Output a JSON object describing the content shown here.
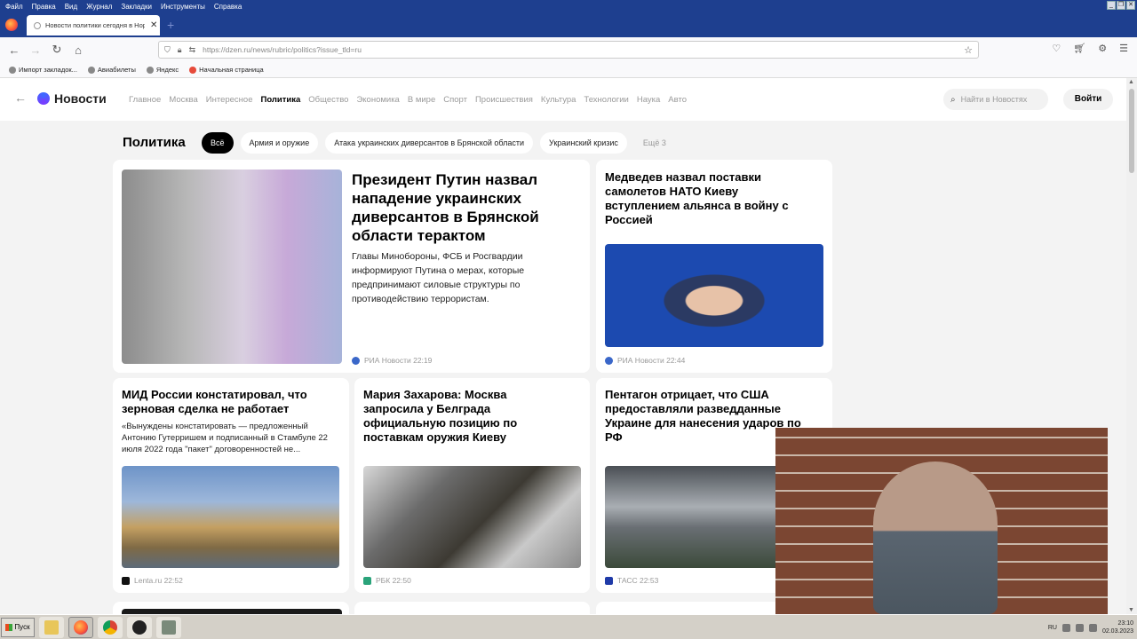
{
  "browser": {
    "menu": [
      "Файл",
      "Правка",
      "Вид",
      "Журнал",
      "Закладки",
      "Инструменты",
      "Справка"
    ],
    "tab_title": "Новости политики сегодня в Нор",
    "url": "https://dzen.ru/news/rubric/politics?issue_tld=ru",
    "bookmarks": [
      "Импорт закладок...",
      "Авиабилеты",
      "Яндекс",
      "Начальная страница"
    ]
  },
  "site": {
    "logo": "Новости",
    "nav": [
      "Главное",
      "Москва",
      "Интересное",
      "Политика",
      "Общество",
      "Экономика",
      "В мире",
      "Спорт",
      "Происшествия",
      "Культура",
      "Технологии",
      "Наука",
      "Авто"
    ],
    "active_nav": "Политика",
    "search_placeholder": "Найти в Новостях",
    "login": "Войти"
  },
  "section": {
    "title": "Политика",
    "chips": [
      "Всё",
      "Армия и оружие",
      "Атака украинских диверсантов в Брянской области",
      "Украинский кризис",
      "Ещё 3"
    ]
  },
  "cards": [
    {
      "headline": "Президент Путин назвал нападение украинских диверсантов в Брянской области терактом",
      "desc": "Главы Минобороны, ФСБ и Росгвардии информируют Путина о мерах, которые предпринимают силовые структуры по противодействию террористам.",
      "source": "РИА Новости",
      "time": "22:19",
      "source_color": "#3a67c9"
    },
    {
      "headline": "Медведев назвал поставки самолетов НАТО Киеву вступлением альянса в войну с Россией",
      "source": "РИА Новости",
      "time": "22:44",
      "source_color": "#3a67c9"
    },
    {
      "headline": "МИД России констатировал, что зерновая сделка не работает",
      "desc": "«Вынуждены констатировать — предложенный Антонию Гутерришем и подписанный в Стамбуле 22 июля 2022 года \"пакет\" договоренностей не...",
      "source": "Lenta.ru",
      "time": "22:52",
      "source_color": "#111111"
    },
    {
      "headline": "Мария Захарова: Москва запросила у Белграда официальную позицию по поставкам оружия Киеву",
      "source": "РБК",
      "time": "22:50",
      "source_color": "#2aa37a"
    },
    {
      "headline": "Пентагон отрицает, что США предоставляли разведданные Украине для нанесения ударов по РФ",
      "source": "ТАСС",
      "time": "22:53",
      "source_color": "#1f3aa8"
    }
  ],
  "taskbar": {
    "start": "Пуск",
    "lang": "RU",
    "time": "23:10",
    "date": "02.03.2023"
  }
}
